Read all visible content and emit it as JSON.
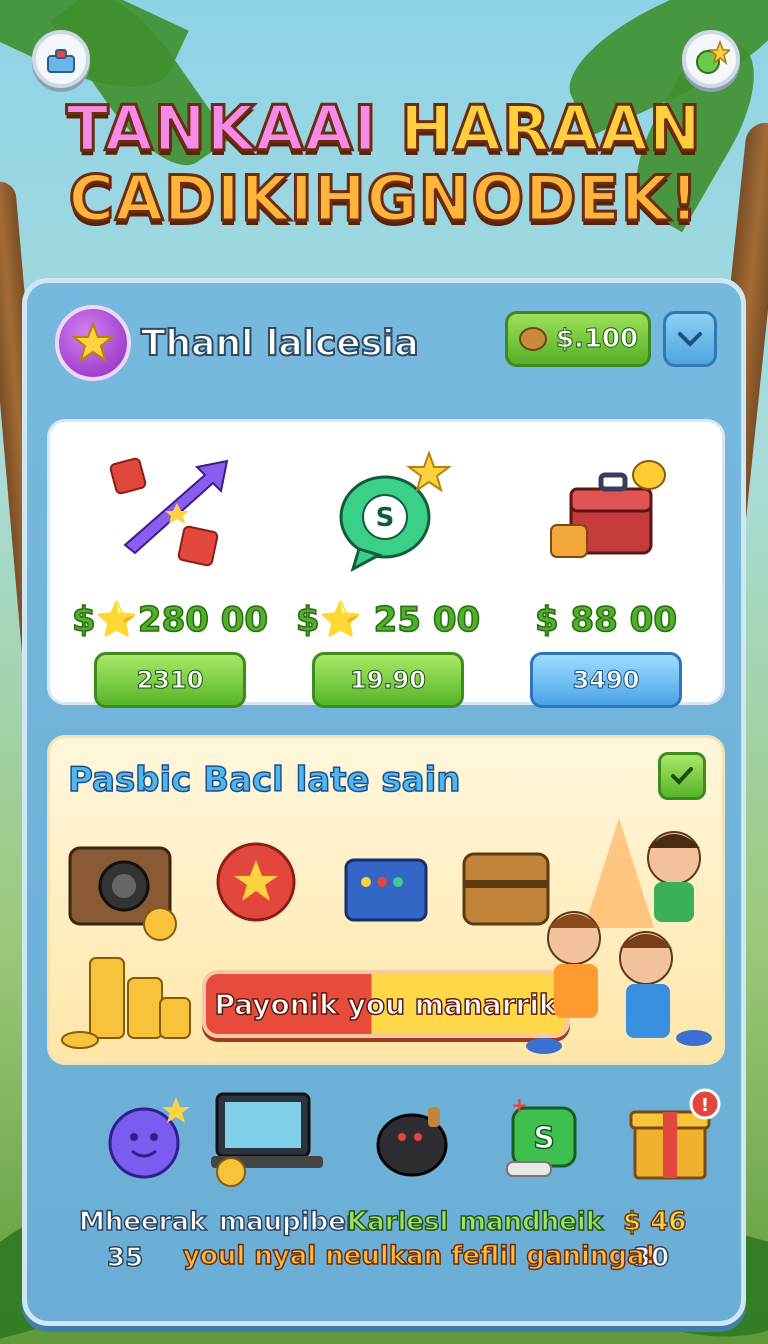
{
  "title": {
    "line1_part_a": "TANKAAI",
    "line1_part_b": "HARAAN",
    "line2": "CADIKIHGNODEK!"
  },
  "header": {
    "panel_title": "Thanl lalcesia",
    "coin_amount": "$.100"
  },
  "shop": {
    "items": [
      {
        "price": "$⭐280 00",
        "button": "2310",
        "icon": "arrow-dice-icon"
      },
      {
        "price": "$⭐ 25  00",
        "button": "19.90",
        "icon": "chat-bubble-coin-icon"
      },
      {
        "price": "$ 88 00",
        "button": "3490",
        "icon": "treasure-chest-icon"
      }
    ]
  },
  "promo": {
    "title": "Pasbic Bacl late sain",
    "cta": "Payonik you manarrik"
  },
  "bottom": {
    "items": [
      {
        "label": "Mheerak",
        "count": "35",
        "icon": "smiley-orb-icon"
      },
      {
        "label": "maupiber",
        "icon": "laptop-icon"
      },
      {
        "label": "Karlesl",
        "icon": "speaker-creature-icon"
      },
      {
        "label": "mandheik",
        "icon": "green-gift-s-icon"
      },
      {
        "label": "$ 46",
        "count": "30",
        "icon": "gift-box-icon"
      }
    ],
    "footer": "youl nyal neulkan feflil ganinga!"
  },
  "colors": {
    "panel": "#6aaed6",
    "green_button": "#57b52b",
    "blue_button": "#4ba3e8",
    "cta_red": "#e64b3c",
    "cta_yellow": "#ffd84a"
  }
}
